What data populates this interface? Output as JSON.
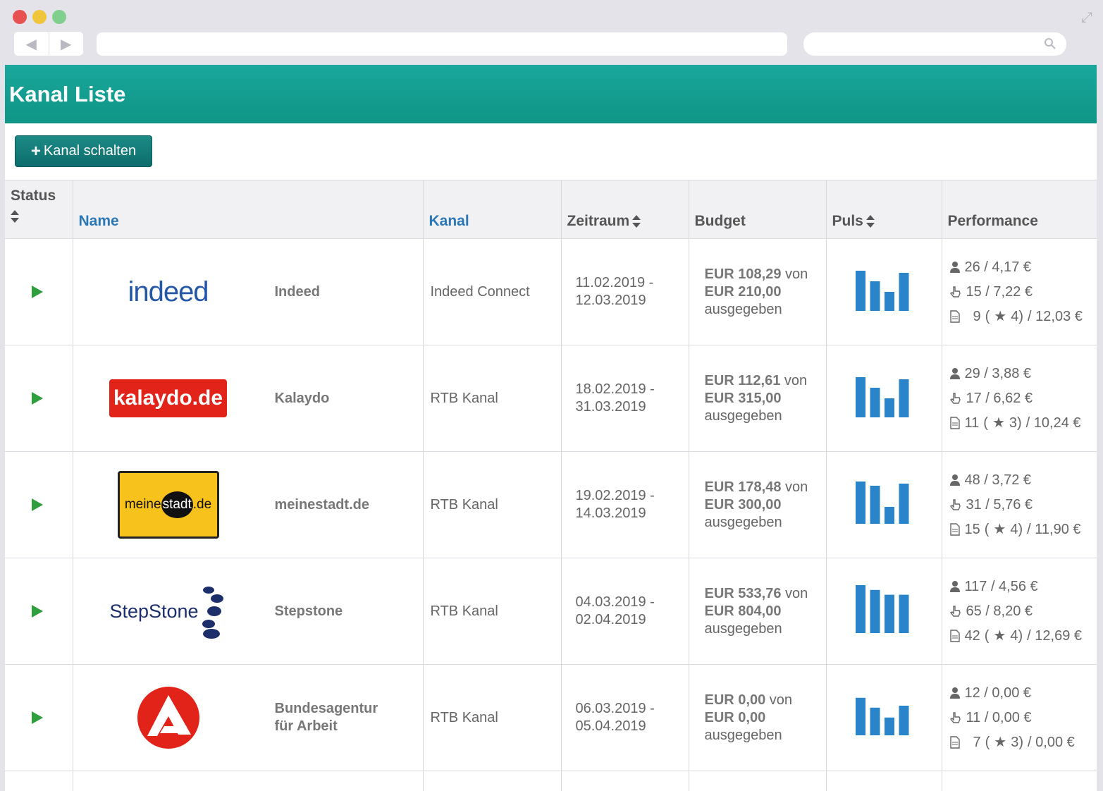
{
  "page": {
    "title": "Kanal Liste",
    "add_button": "Kanal schalten"
  },
  "columns": {
    "status": "Status",
    "name": "Name",
    "kanal": "Kanal",
    "zeitraum": "Zeitraum",
    "budget": "Budget",
    "puls": "Puls",
    "performance": "Performance"
  },
  "colors": {
    "header": "#119a8b",
    "button": "#147c79",
    "link": "#2b77b5",
    "play": "#2f9e3d",
    "bar": "#2a84c9"
  },
  "rows": [
    {
      "logo_text": "indeed",
      "name": "Indeed",
      "kanal": "Indeed Connect",
      "zeit_from": "11.02.2019 -",
      "zeit_to": "12.03.2019",
      "spent": "EUR 108,29",
      "von": "von",
      "total": "EUR 210,00",
      "ausgegeben": "ausgegeben",
      "puls": [
        0.95,
        0.7,
        0.45,
        0.9
      ],
      "perf_views": "26 / 4,17 €",
      "perf_clicks": "15 / 7,22 €",
      "perf_apps_count": "9",
      "perf_apps_star_open": "(",
      "perf_apps_star_val": "4)",
      "perf_apps_cost": "/ 12,03 €"
    },
    {
      "logo_text": "kalaydo.de",
      "name": "Kalaydo",
      "kanal": "RTB Kanal",
      "zeit_from": "18.02.2019 -",
      "zeit_to": "31.03.2019",
      "spent": "EUR 112,61",
      "von": "von",
      "total": "EUR 315,00",
      "ausgegeben": "ausgegeben",
      "puls": [
        0.95,
        0.7,
        0.45,
        0.9
      ],
      "perf_views": "29 / 3,88 €",
      "perf_clicks": "17 / 6,62 €",
      "perf_apps_count": "11",
      "perf_apps_star_open": "(",
      "perf_apps_star_val": "3)",
      "perf_apps_cost": "/ 10,24 €"
    },
    {
      "logo_text_a": "meine",
      "logo_text_b": "stadt",
      "logo_text_c": ".de",
      "name": "meinestadt.de",
      "kanal": "RTB Kanal",
      "zeit_from": "19.02.2019 -",
      "zeit_to": "14.03.2019",
      "spent": "EUR 178,48",
      "von": "von",
      "total": "EUR 300,00",
      "ausgegeben": "ausgegeben",
      "puls": [
        1.0,
        0.9,
        0.4,
        0.95
      ],
      "perf_views": "48 / 3,72 €",
      "perf_clicks": "31 / 5,76 €",
      "perf_apps_count": "15",
      "perf_apps_star_open": "(",
      "perf_apps_star_val": "4)",
      "perf_apps_cost": "/ 11,90 €"
    },
    {
      "logo_text": "StepStone",
      "name": "Stepstone",
      "kanal": "RTB Kanal",
      "zeit_from": "04.03.2019 -",
      "zeit_to": "02.04.2019",
      "spent": "EUR 533,76",
      "von": "von",
      "total": "EUR 804,00",
      "ausgegeben": "ausgegeben",
      "puls": [
        1.0,
        0.9,
        0.8,
        0.8
      ],
      "perf_views": "117 / 4,56 €",
      "perf_clicks": "65 / 8,20 €",
      "perf_apps_count": "42",
      "perf_apps_star_open": "(",
      "perf_apps_star_val": "4)",
      "perf_apps_cost": "/ 12,69 €"
    },
    {
      "logo_text": "",
      "name": "Bundesagentur für Arbeit",
      "kanal": "RTB Kanal",
      "zeit_from": "06.03.2019 -",
      "zeit_to": "05.04.2019",
      "spent": "EUR 0,00",
      "von": "von",
      "total": "EUR 0,00",
      "ausgegeben": "ausgegeben",
      "puls": [
        0.95,
        0.7,
        0.45,
        0.75
      ],
      "perf_views": "12 / 0,00 €",
      "perf_clicks": "11 / 0,00 €",
      "perf_apps_count": "7",
      "perf_apps_star_open": "(",
      "perf_apps_star_val": "3)",
      "perf_apps_cost": "/ 0,00 €"
    }
  ]
}
